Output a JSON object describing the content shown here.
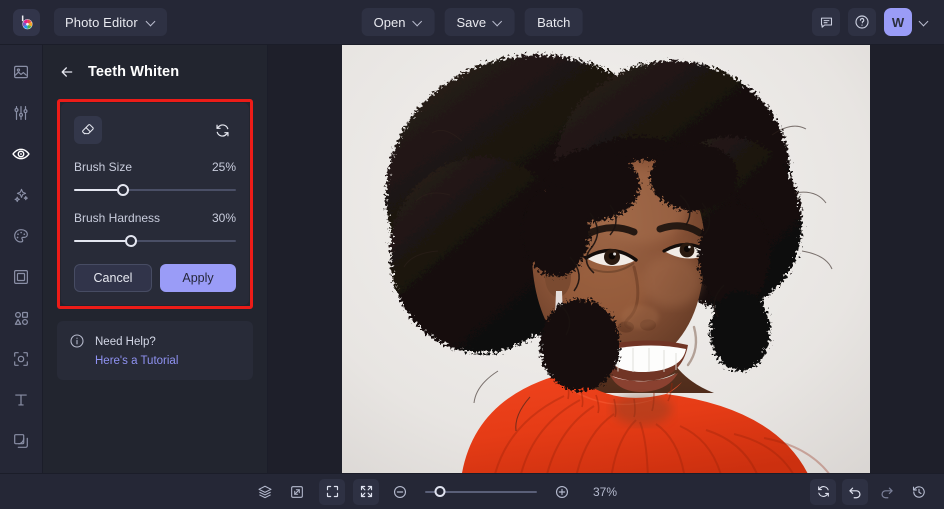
{
  "app": {
    "logo_icon": "color-wheel-b-logo",
    "switcher_label": "Photo Editor"
  },
  "topbar": {
    "open_label": "Open",
    "save_label": "Save",
    "batch_label": "Batch",
    "feedback_icon": "chat-bubble-icon",
    "help_icon": "question-circle-icon",
    "avatar_initial": "W",
    "avatar_color": "#9a9cf7"
  },
  "sidebar": {
    "items": [
      {
        "name": "sidebar-item-image",
        "icon": "image-icon",
        "active": false
      },
      {
        "name": "sidebar-item-adjust",
        "icon": "sliders-icon",
        "active": false
      },
      {
        "name": "sidebar-item-retouch",
        "icon": "eye-icon",
        "active": true
      },
      {
        "name": "sidebar-item-effects",
        "icon": "sparkles-icon",
        "active": false
      },
      {
        "name": "sidebar-item-color",
        "icon": "palette-icon",
        "active": false
      },
      {
        "name": "sidebar-item-frames",
        "icon": "frame-icon",
        "active": false
      },
      {
        "name": "sidebar-item-shapes",
        "icon": "shapes-icon",
        "active": false
      },
      {
        "name": "sidebar-item-cutout",
        "icon": "cutout-icon",
        "active": false
      },
      {
        "name": "sidebar-item-text",
        "icon": "text-t-icon",
        "active": false
      },
      {
        "name": "sidebar-item-layers",
        "icon": "overlay-icon",
        "active": false
      }
    ]
  },
  "panel": {
    "back_icon": "back-arrow-icon",
    "title": "Teeth Whiten",
    "highlight_color": "#ec1c18",
    "eraser_icon": "eraser-icon",
    "reset_icon": "reset-arrows-icon",
    "sliders": [
      {
        "label": "Brush Size",
        "value": "25%",
        "percent": 25
      },
      {
        "label": "Brush Hardness",
        "value": "30%",
        "percent": 30
      }
    ],
    "cancel_label": "Cancel",
    "apply_label": "Apply",
    "apply_color": "#9a9cf7",
    "help": {
      "icon": "info-circle-icon",
      "title": "Need Help?",
      "link": "Here's a Tutorial",
      "link_color": "#8f92f2"
    }
  },
  "canvas": {
    "photo_alt": "Smiling woman with curly afro hair wearing a red-orange knit sweater on a light background"
  },
  "bottombar": {
    "layers_icon": "layers-icon",
    "compare_icon": "compare-swap-icon",
    "grid_icon": "grid-four-icon",
    "fullscreen_icon": "fullscreen-expand-icon",
    "fit_icon": "fit-to-screen-icon",
    "zoom_out_icon": "minus-circle-icon",
    "zoom_in_icon": "plus-circle-icon",
    "zoom_level": "37%",
    "zoom_percent": 13,
    "reset_icon": "reset-arrows-icon",
    "undo_icon": "undo-arrow-icon",
    "redo_icon": "redo-arrow-icon",
    "history_icon": "history-clock-icon"
  }
}
